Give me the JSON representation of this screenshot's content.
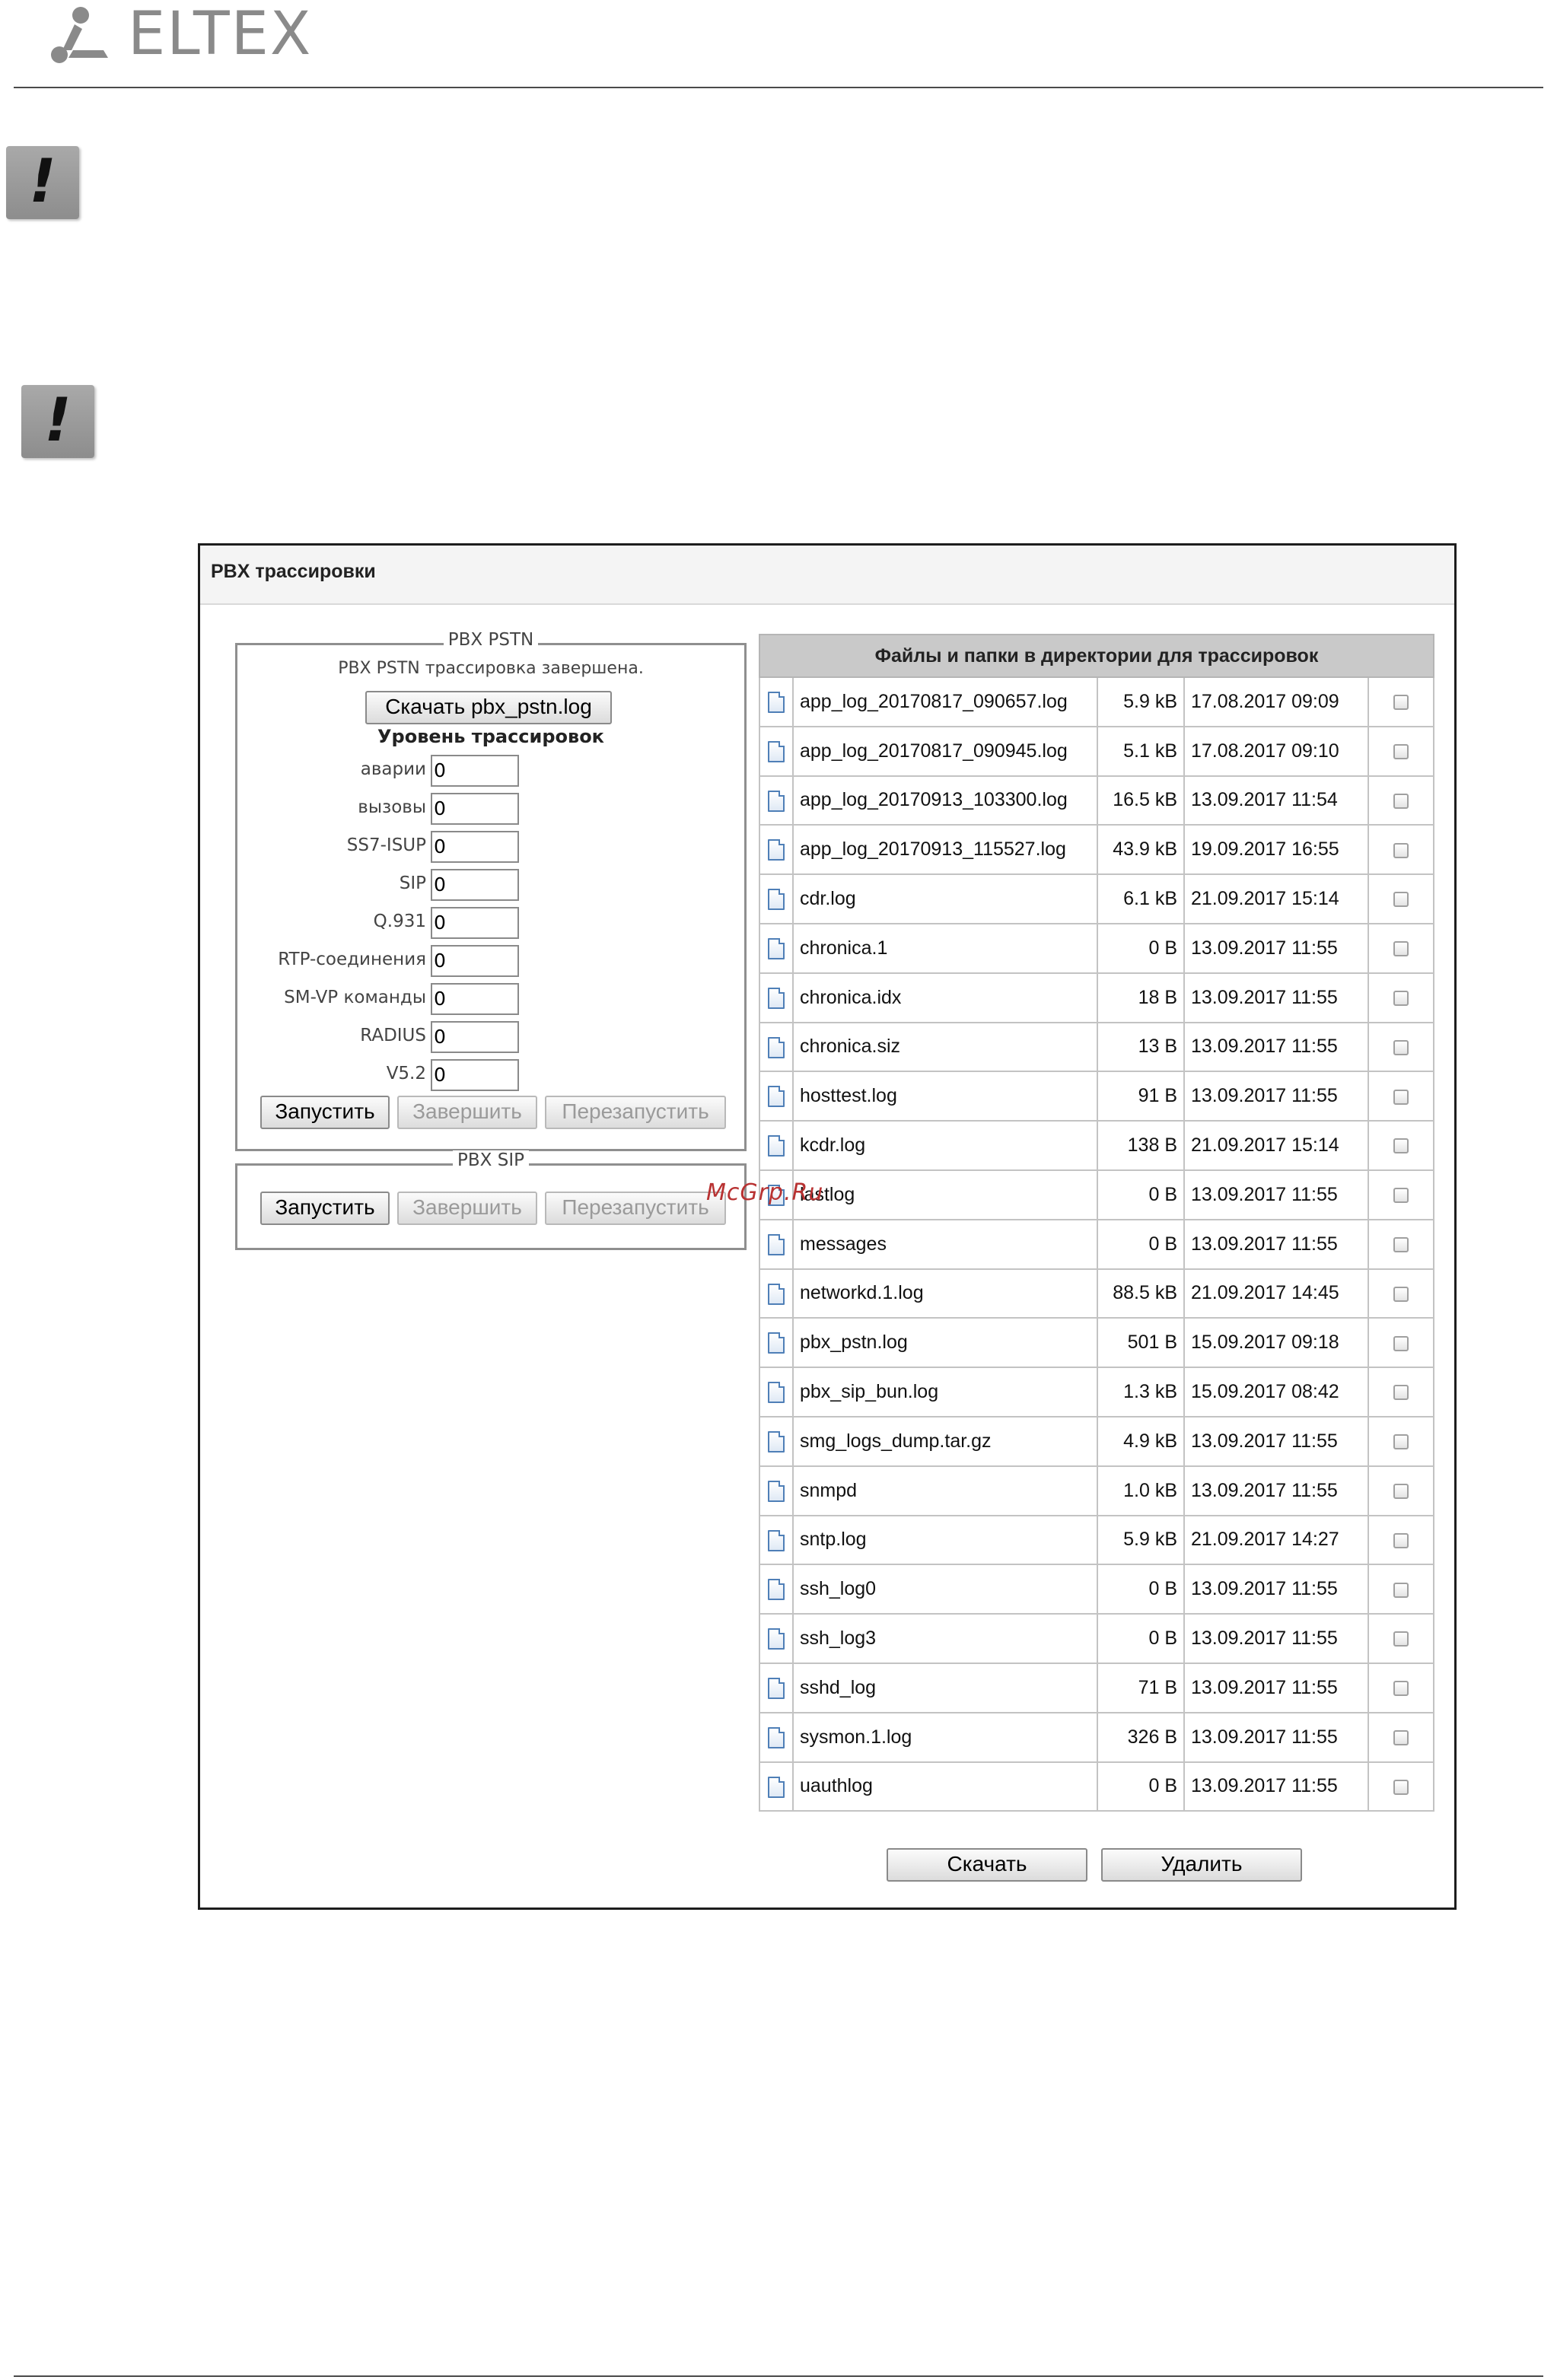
{
  "header": {
    "logo_text": "ELTEX",
    "logo_icon": "eltex-logo-icon",
    "warning_icon": "exclamation-icon"
  },
  "window": {
    "title": "PBX трассировки"
  },
  "pstn": {
    "legend": "PBX PSTN",
    "status": "PBX PSTN трассировка завершена.",
    "download_label": "Скачать pbx_pstn.log",
    "level_title": "Уровень трассировок",
    "levels": [
      {
        "label": "аварии",
        "value": "0"
      },
      {
        "label": "вызовы",
        "value": "0"
      },
      {
        "label": "SS7-ISUP",
        "value": "0"
      },
      {
        "label": "SIP",
        "value": "0"
      },
      {
        "label": "Q.931",
        "value": "0"
      },
      {
        "label": "RTP-соединения",
        "value": "0"
      },
      {
        "label": "SM-VP команды",
        "value": "0"
      },
      {
        "label": "RADIUS",
        "value": "0"
      },
      {
        "label": "V5.2",
        "value": "0"
      }
    ],
    "start_label": "Запустить",
    "stop_label": "Завершить",
    "restart_label": "Перезапустить"
  },
  "sip": {
    "legend": "PBX SIP",
    "start_label": "Запустить",
    "stop_label": "Завершить",
    "restart_label": "Перезапустить"
  },
  "files": {
    "header": "Файлы и папки в директории для трассировок",
    "file_icon": "document-icon",
    "rows": [
      {
        "name": "app_log_20170817_090657.log",
        "size": "5.9 kB",
        "date": "17.08.2017 09:09"
      },
      {
        "name": "app_log_20170817_090945.log",
        "size": "5.1 kB",
        "date": "17.08.2017 09:10"
      },
      {
        "name": "app_log_20170913_103300.log",
        "size": "16.5 kB",
        "date": "13.09.2017 11:54"
      },
      {
        "name": "app_log_20170913_115527.log",
        "size": "43.9 kB",
        "date": "19.09.2017 16:55"
      },
      {
        "name": "cdr.log",
        "size": "6.1 kB",
        "date": "21.09.2017 15:14"
      },
      {
        "name": "chronica.1",
        "size": "0 B",
        "date": "13.09.2017 11:55"
      },
      {
        "name": "chronica.idx",
        "size": "18 B",
        "date": "13.09.2017 11:55"
      },
      {
        "name": "chronica.siz",
        "size": "13 B",
        "date": "13.09.2017 11:55"
      },
      {
        "name": "hosttest.log",
        "size": "91 B",
        "date": "13.09.2017 11:55"
      },
      {
        "name": "kcdr.log",
        "size": "138 B",
        "date": "21.09.2017 15:14"
      },
      {
        "name": "lastlog",
        "size": "0 B",
        "date": "13.09.2017 11:55"
      },
      {
        "name": "messages",
        "size": "0 B",
        "date": "13.09.2017 11:55"
      },
      {
        "name": "networkd.1.log",
        "size": "88.5 kB",
        "date": "21.09.2017 14:45"
      },
      {
        "name": "pbx_pstn.log",
        "size": "501 B",
        "date": "15.09.2017 09:18"
      },
      {
        "name": "pbx_sip_bun.log",
        "size": "1.3 kB",
        "date": "15.09.2017 08:42"
      },
      {
        "name": "smg_logs_dump.tar.gz",
        "size": "4.9 kB",
        "date": "13.09.2017 11:55"
      },
      {
        "name": "snmpd",
        "size": "1.0 kB",
        "date": "13.09.2017 11:55"
      },
      {
        "name": "sntp.log",
        "size": "5.9 kB",
        "date": "21.09.2017 14:27"
      },
      {
        "name": "ssh_log0",
        "size": "0 B",
        "date": "13.09.2017 11:55"
      },
      {
        "name": "ssh_log3",
        "size": "0 B",
        "date": "13.09.2017 11:55"
      },
      {
        "name": "sshd_log",
        "size": "71 B",
        "date": "13.09.2017 11:55"
      },
      {
        "name": "sysmon.1.log",
        "size": "326 B",
        "date": "13.09.2017 11:55"
      },
      {
        "name": "uauthlog",
        "size": "0 B",
        "date": "13.09.2017 11:55"
      }
    ],
    "download_label": "Скачать",
    "delete_label": "Удалить"
  },
  "watermark": "McGrp.Ru"
}
